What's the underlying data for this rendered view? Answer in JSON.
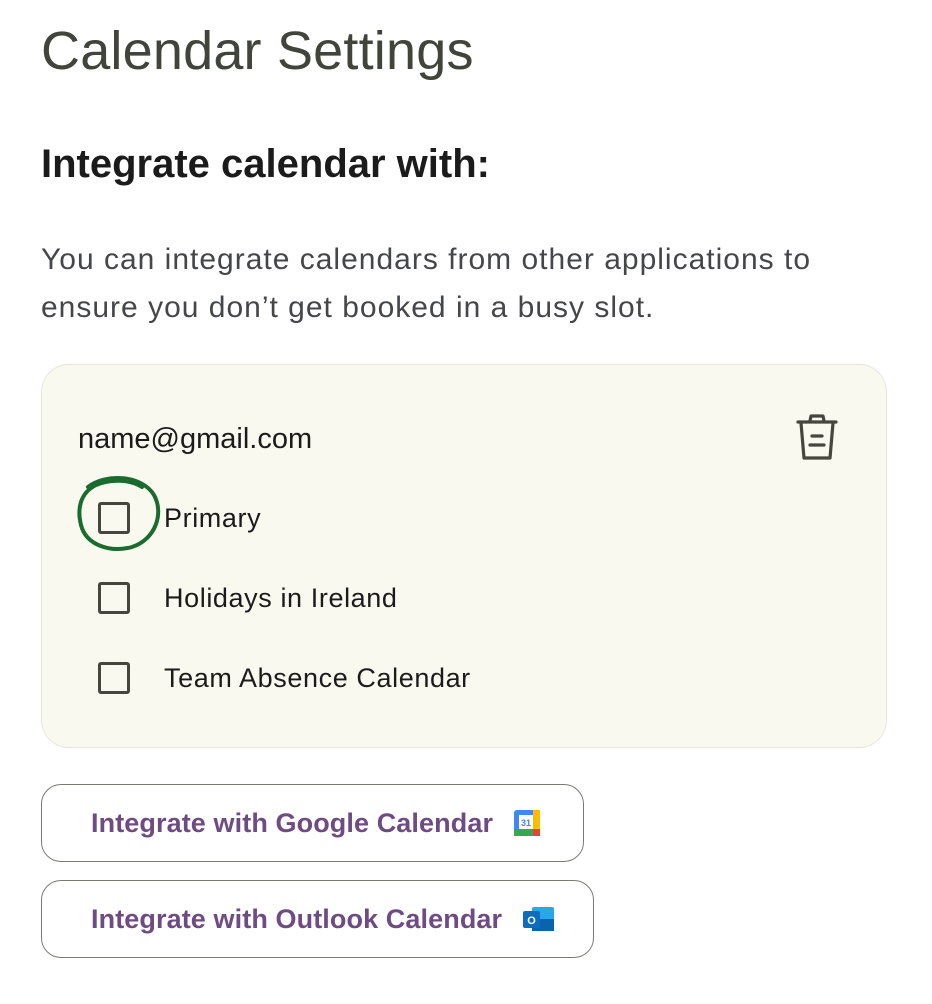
{
  "page": {
    "title": "Calendar Settings"
  },
  "integration": {
    "heading": "Integrate calendar with:",
    "description": "You can integrate calendars from other applications to ensure you don’t get booked in a busy slot."
  },
  "account": {
    "email": "name@gmail.com",
    "delete_icon": "trash-icon",
    "calendars": [
      {
        "label": "Primary",
        "checked": false,
        "highlighted": true
      },
      {
        "label": "Holidays in Ireland",
        "checked": false
      },
      {
        "label": "Team Absence Calendar",
        "checked": false
      }
    ]
  },
  "buttons": {
    "google": {
      "label": "Integrate with Google Calendar",
      "icon": "google-calendar-icon",
      "icon_text": "31"
    },
    "outlook": {
      "label": "Integrate with Outlook Calendar",
      "icon": "outlook-icon",
      "icon_text": "O"
    }
  },
  "colors": {
    "card_background": "#f9f9ef",
    "button_text": "#6e4b82",
    "annotation": "#1a6b2e"
  }
}
